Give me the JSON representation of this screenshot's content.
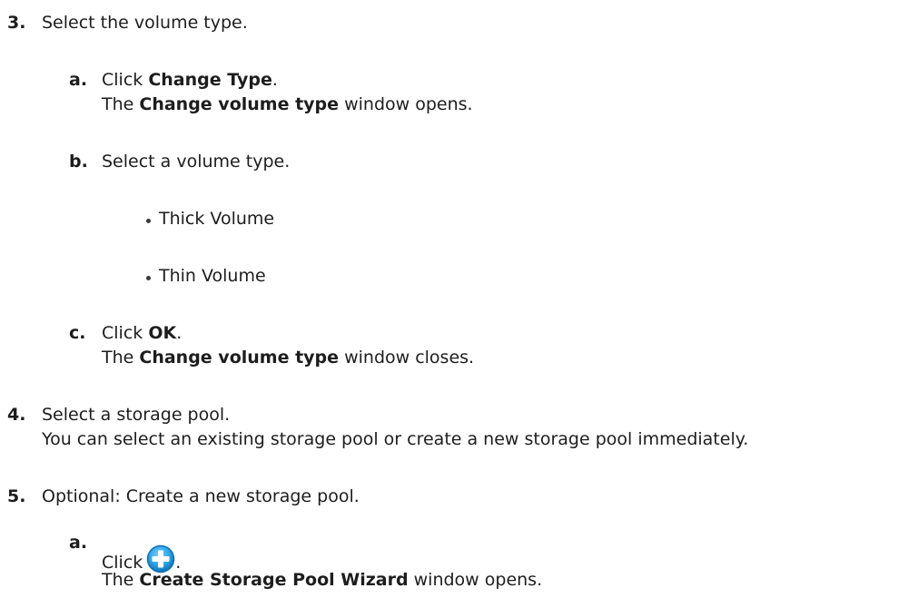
{
  "steps": {
    "s3": {
      "number": "3.",
      "text": "Select the volume type.",
      "a": {
        "letter": "a.",
        "pre": "Click ",
        "bold": "Change Type",
        "post": ".",
        "result_pre": "The ",
        "result_bold": "Change volume type",
        "result_post": " window opens."
      },
      "b": {
        "letter": "b.",
        "text": "Select a volume type.",
        "options": [
          "Thick Volume",
          "Thin Volume"
        ]
      },
      "c": {
        "letter": "c.",
        "pre": "Click ",
        "bold": "OK",
        "post": ".",
        "result_pre": "The ",
        "result_bold": "Change volume type",
        "result_post": " window closes."
      }
    },
    "s4": {
      "number": "4.",
      "text": "Select a storage pool.",
      "detail": "You can select an existing storage pool or create a new storage pool immediately."
    },
    "s5": {
      "number": "5.",
      "text": "Optional: Create a new storage pool.",
      "a": {
        "letter": "a.",
        "pre": "Click",
        "icon": "add-circle-icon",
        "post": ".",
        "result_pre": "The ",
        "result_bold": "Create Storage Pool Wizard",
        "result_post": " window opens."
      }
    }
  },
  "colors": {
    "text": "#1d1d1d",
    "icon_fill": "#2aa5e8",
    "icon_ring": "#0f6fb7"
  }
}
